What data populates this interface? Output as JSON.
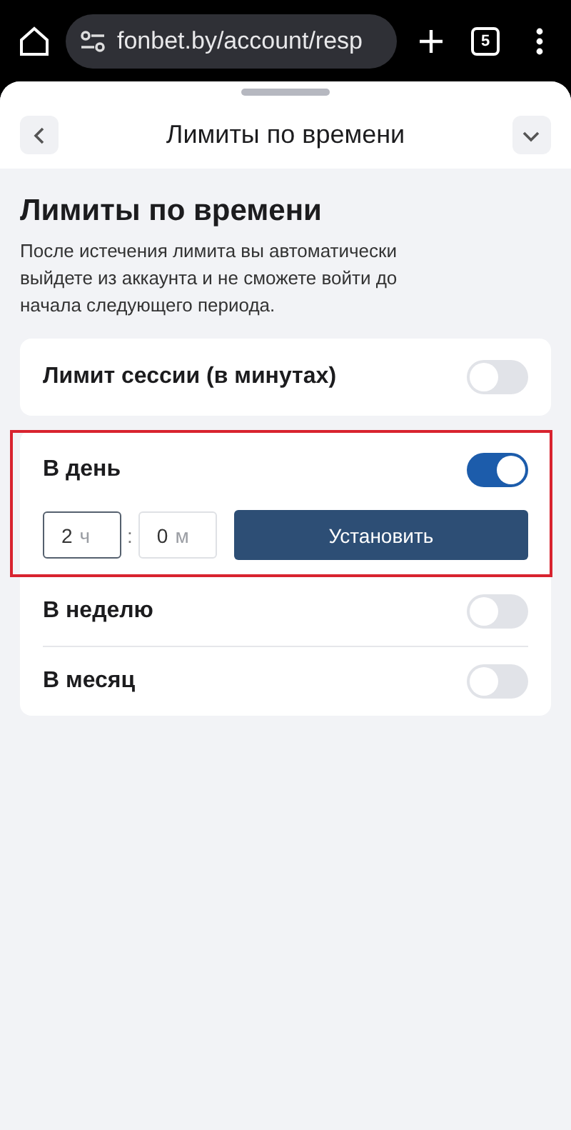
{
  "browser": {
    "url": "fonbet.by/account/resp",
    "tab_count": "5"
  },
  "header": {
    "title": "Лимиты по времени"
  },
  "heading": "Лимиты по времени",
  "description": "После истечения лимита вы автоматически выйдете из аккаунта и не сможете войти до начала следующего периода.",
  "session": {
    "label": "Лимит сессии (в минутах)",
    "on": false
  },
  "periods": [
    {
      "label": "В день",
      "on": true,
      "highlighted": true,
      "fields": [
        {
          "value": "2",
          "unit": "ч",
          "focused": true
        },
        {
          "value": "0",
          "unit": "м",
          "focused": false
        }
      ],
      "separator": ":",
      "button": "Установить"
    },
    {
      "label": "В неделю",
      "on": false,
      "highlighted": false
    },
    {
      "label": "В месяц",
      "on": false,
      "highlighted": false
    }
  ]
}
